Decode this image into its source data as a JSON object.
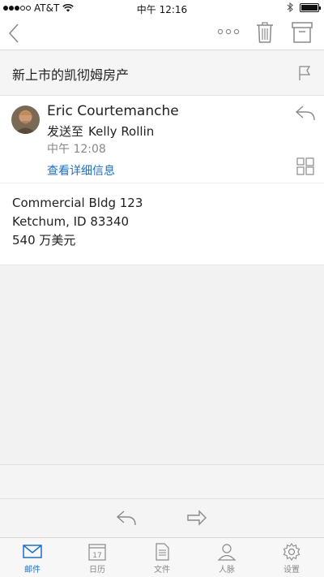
{
  "status_bar": {
    "carrier": "AT&T",
    "time": "中午 12:16",
    "signal_bars": 3,
    "signal_total": 5
  },
  "toolbar": {
    "back_icon": "chevron-left-icon",
    "more_icon": "more-icon",
    "trash_icon": "trash-icon",
    "archive_icon": "archive-icon"
  },
  "message": {
    "subject": "新上市的凯彻姆房产",
    "sender": "Eric Courtemanche",
    "sent_to_prefix": "发送至",
    "recipient": "Kelly Rollin",
    "time": "中午 12:08",
    "details_link": "查看详细信息",
    "body_lines": [
      "Commercial Bldg 123",
      "Ketchum, ID 83340",
      "540 万美元"
    ]
  },
  "tabs": [
    {
      "label": "邮件",
      "icon": "mail-icon",
      "active": true
    },
    {
      "label": "日历",
      "icon": "calendar-icon",
      "day": "17"
    },
    {
      "label": "文件",
      "icon": "file-icon"
    },
    {
      "label": "人脉",
      "icon": "person-icon"
    },
    {
      "label": "设置",
      "icon": "gear-icon"
    }
  ],
  "colors": {
    "accent": "#1e6fc5",
    "secondary_text": "#888888",
    "icon_gray": "#8a8a8a"
  }
}
